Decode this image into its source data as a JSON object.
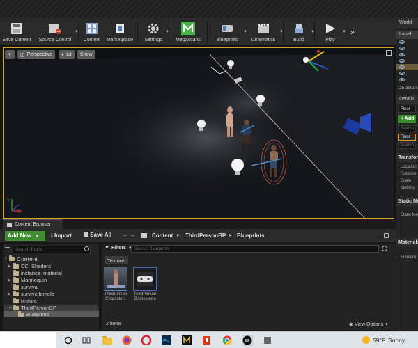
{
  "toolbar": {
    "save_current": "Save Current",
    "source_control": "Source Control",
    "content": "Content",
    "marketplace": "Marketplace",
    "settings": "Settings",
    "megascans": "Megascans",
    "blueprints": "Blueprints",
    "cinematics": "Cinematics",
    "build": "Build",
    "play": "Play"
  },
  "viewport": {
    "perspective": "Perspective",
    "lit": "Lit",
    "show": "Show"
  },
  "outliner": {
    "tab_label": "World",
    "column_label": "Label",
    "actor_count": "25 actors"
  },
  "details": {
    "tab_label": "Details",
    "object_name": "Floor",
    "add_button": "+ Add",
    "search_placeholder": "Search C",
    "selected_component": "Floor",
    "search_details_placeholder": "Search D",
    "transform_header": "Transform",
    "location": "Location",
    "rotation": "Rotation",
    "scale": "Scale",
    "mobility": "Mobility",
    "static_mesh_header": "Static Mesh",
    "static_mesh_label": "Static Mesh",
    "materials_header": "Materials",
    "element_label": "Element"
  },
  "content_browser": {
    "tab_label": "Content Browser",
    "add_new": "Add New",
    "import": "Import",
    "save_all": "Save All",
    "breadcrumb": [
      "Content",
      "ThirdPersonBP",
      "Blueprints"
    ],
    "search_paths_placeholder": "Search Paths",
    "filters_label": "Filters",
    "search_placeholder": "Search Blueprints",
    "texture_tag": "Texture",
    "tree": [
      {
        "label": "Content",
        "depth": 0
      },
      {
        "label": "CC_Shaders",
        "depth": 1
      },
      {
        "label": "instance_material",
        "depth": 1
      },
      {
        "label": "Mannequin",
        "depth": 1
      },
      {
        "label": "survival",
        "depth": 1
      },
      {
        "label": "survivelfemela",
        "depth": 1
      },
      {
        "label": "texture",
        "depth": 1
      },
      {
        "label": "ThirdPersonBP",
        "depth": 1
      },
      {
        "label": "Blueprints",
        "depth": 2
      }
    ],
    "assets": [
      {
        "name": "ThirdPerson Character1"
      },
      {
        "name": "ThirdPerson GameMode"
      }
    ],
    "item_count": "2 items",
    "view_options": "View Options"
  },
  "taskbar": {
    "weather_temp": "59°F",
    "weather_desc": "Sunny"
  },
  "colors": {
    "accent_green": "#3f8c31",
    "selection_orange": "#d6a52a",
    "megascans_green": "#4cb04a"
  }
}
